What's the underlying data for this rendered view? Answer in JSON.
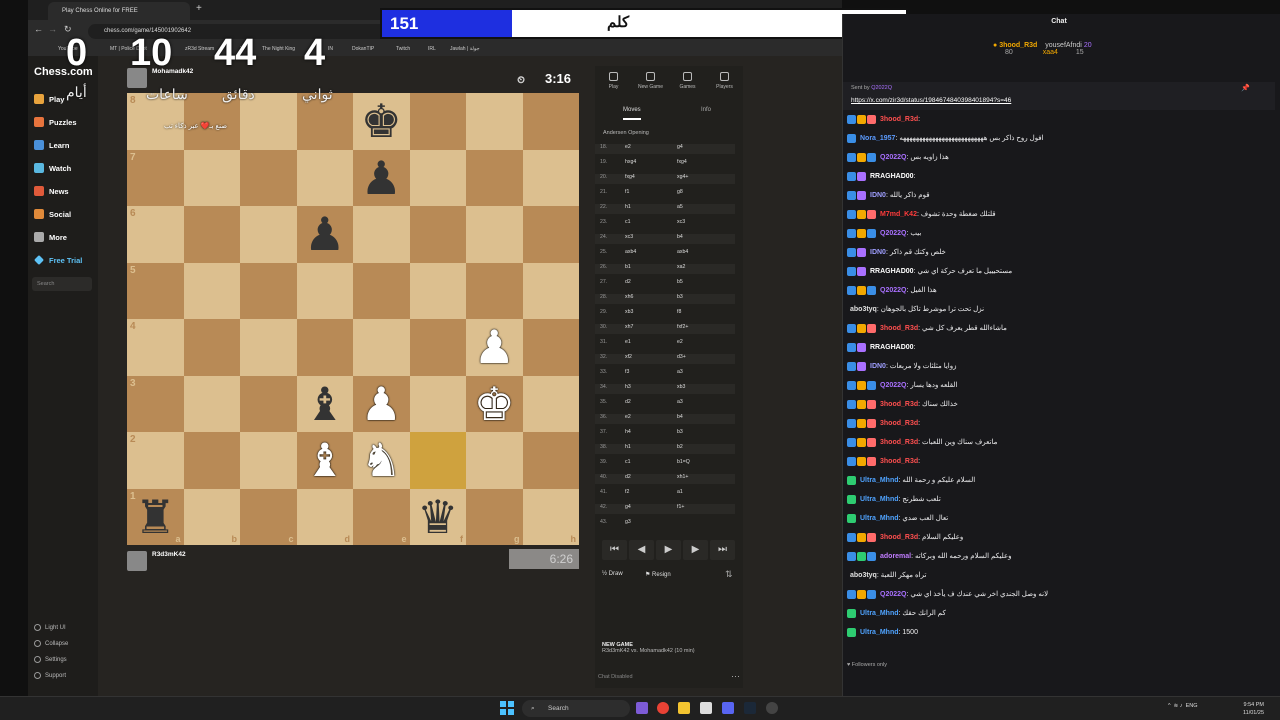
{
  "browser": {
    "tab_title": "Play Chess Online for FREE",
    "url": "chess.com/game/145001902642",
    "bookmarks": [
      "YouTube",
      "MT | Police Dept",
      "zR3d Stream",
      "X",
      "IN",
      "The Night King",
      "DokanTIP",
      "Twitch",
      "IRL",
      "Jawlah | جولة"
    ]
  },
  "overlay": {
    "blue_score": "151",
    "center_word": "كلم",
    "right_score": "593",
    "countdown": {
      "days": "0",
      "hours": "10",
      "minutes": "44",
      "seconds": "4"
    },
    "countdown_labels": {
      "days": "أيام",
      "hours": "ساعات",
      "minutes": "دقائق",
      "seconds": "ثواني"
    },
    "credit": "صنع بـ❤️ عبر ذكاء تب"
  },
  "chess_sidebar": {
    "logo": "Chess.com",
    "items": [
      "Play",
      "Puzzles",
      "Learn",
      "Watch",
      "News",
      "Social",
      "More",
      "Free Trial"
    ],
    "search_placeholder": "Search",
    "bottom": [
      "Light UI",
      "Collapse",
      "Settings",
      "Support"
    ]
  },
  "game": {
    "top_player": {
      "name": "Mohamadk42",
      "clock": "3:16"
    },
    "bottom_player": {
      "name": "R3d3mK42",
      "clock": "6:26"
    },
    "ranks": [
      "8",
      "7",
      "6",
      "5",
      "4",
      "3",
      "2",
      "1"
    ],
    "files": [
      "a",
      "b",
      "c",
      "d",
      "e",
      "f",
      "g",
      "h"
    ],
    "pieces": [
      {
        "square": "e8",
        "glyph": "♚",
        "color": "black",
        "name": "black-king"
      },
      {
        "square": "e7",
        "glyph": "♟",
        "color": "black",
        "name": "black-pawn"
      },
      {
        "square": "d6",
        "glyph": "♟",
        "color": "black",
        "name": "black-pawn"
      },
      {
        "square": "g4",
        "glyph": "♟",
        "color": "white",
        "name": "white-pawn"
      },
      {
        "square": "d3",
        "glyph": "♝",
        "color": "black",
        "name": "black-bishop"
      },
      {
        "square": "e3",
        "glyph": "♟",
        "color": "white",
        "name": "white-pawn"
      },
      {
        "square": "g3",
        "glyph": "♚",
        "color": "white",
        "name": "white-king"
      },
      {
        "square": "d2",
        "glyph": "♝",
        "color": "white",
        "name": "white-bishop"
      },
      {
        "square": "e2",
        "glyph": "♞",
        "color": "white",
        "name": "white-knight"
      },
      {
        "square": "a1",
        "glyph": "♜",
        "color": "black",
        "name": "black-rook"
      },
      {
        "square": "f1",
        "glyph": "♛",
        "color": "black",
        "name": "black-queen"
      }
    ],
    "highlight": [
      "f2"
    ]
  },
  "panel": {
    "tabs": [
      "Play",
      "New Game",
      "Games",
      "Players"
    ],
    "subtabs": [
      "Moves",
      "Info"
    ],
    "opening": "Andersen Opening",
    "moves": [
      {
        "n": "18.",
        "w": "e2",
        "b": "g4"
      },
      {
        "n": "19.",
        "w": "hxg4",
        "b": "fxg4"
      },
      {
        "n": "20.",
        "w": "fxg4",
        "b": "xg4+"
      },
      {
        "n": "21.",
        "w": "f1",
        "b": "g8"
      },
      {
        "n": "22.",
        "w": "h1",
        "b": "a5"
      },
      {
        "n": "23.",
        "w": "c1",
        "b": "xc3"
      },
      {
        "n": "24.",
        "w": "xc3",
        "b": "b4"
      },
      {
        "n": "25.",
        "w": "axb4",
        "b": "axb4"
      },
      {
        "n": "26.",
        "w": "b1",
        "b": "xa2"
      },
      {
        "n": "27.",
        "w": "d2",
        "b": "b5"
      },
      {
        "n": "28.",
        "w": "xh6",
        "b": "b3"
      },
      {
        "n": "29.",
        "w": "xb3",
        "b": "f8"
      },
      {
        "n": "30.",
        "w": "xh7",
        "b": "fxf2+"
      },
      {
        "n": "31.",
        "w": "e1",
        "b": "e2"
      },
      {
        "n": "32.",
        "w": "xf2",
        "b": "d3+"
      },
      {
        "n": "33.",
        "w": "f3",
        "b": "a3"
      },
      {
        "n": "34.",
        "w": "h3",
        "b": "xb3"
      },
      {
        "n": "35.",
        "w": "d2",
        "b": "a3"
      },
      {
        "n": "36.",
        "w": "e2",
        "b": "b4"
      },
      {
        "n": "37.",
        "w": "h4",
        "b": "b3"
      },
      {
        "n": "38.",
        "w": "h1",
        "b": "b2"
      },
      {
        "n": "39.",
        "w": "c1",
        "b": "b1=Q"
      },
      {
        "n": "40.",
        "w": "d2",
        "b": "xh1+"
      },
      {
        "n": "41.",
        "w": "f2",
        "b": "a1"
      },
      {
        "n": "42.",
        "w": "g4",
        "b": "f1+"
      },
      {
        "n": "43.",
        "w": "g3",
        "b": ""
      }
    ],
    "draw": "Draw",
    "resign": "Resign",
    "new_game_title": "NEW GAME",
    "new_game_desc": "R3d3mK42 vs. Mohamadk42 (10 min)",
    "chat_disabled": "Chat Disabled"
  },
  "chat": {
    "title": "Chat",
    "top_users": [
      {
        "name": "3hood_R3d",
        "count": "80"
      },
      {
        "name": "yousefAfndi",
        "count": "20"
      },
      {
        "name": "xaa4",
        "count": "15"
      }
    ],
    "pinned_sender": "Sent by",
    "pinned_sender_name": "Q2022Q",
    "pinned_link": "https://x.com/zir3d/status/1984674840398401894?s=46",
    "messages": [
      {
        "user": "3hood_R3d",
        "color": "#ff4f4f",
        "text": ":",
        "badges": [
          "#3a8ee6",
          "#f2a800",
          "#ff6b6b"
        ]
      },
      {
        "user": "Nora_1957",
        "color": "#5b9bff",
        "text": ": افول روح ذاكر بس ههههههههههههههههههههههههههه",
        "badges": [
          "#3a8ee6"
        ]
      },
      {
        "user": "Q2022Q",
        "color": "#a970ff",
        "text": ": هذا زاويه بس",
        "badges": [
          "#3a8ee6",
          "#f2a800",
          "#3a8ee6"
        ]
      },
      {
        "user": "RRAGHAD00",
        "color": "#ffffff",
        "text": ":",
        "badges": [
          "#3a8ee6",
          "#a970ff"
        ]
      },
      {
        "user": "IDN0",
        "color": "#9e9eff",
        "text": ": قوم ذاكر يالله",
        "badges": [
          "#3a8ee6",
          "#a970ff"
        ]
      },
      {
        "user": "M7md_K42",
        "color": "#ff3b3b",
        "text": ": قلتلك ضغطة وحدة تشوف",
        "badges": [
          "#3a8ee6",
          "#f2a800",
          "#ff6b6b"
        ]
      },
      {
        "user": "Q2022Q",
        "color": "#a970ff",
        "text": ": بيب",
        "badges": [
          "#3a8ee6",
          "#f2a800",
          "#3a8ee6"
        ]
      },
      {
        "user": "IDN0",
        "color": "#9e9eff",
        "text": ": خلص وكتك قم ذاكر",
        "badges": [
          "#3a8ee6",
          "#a970ff"
        ]
      },
      {
        "user": "RRAGHAD00",
        "color": "#ffffff",
        "text": ": مستحيييل ما تعرف حركة اي شي",
        "badges": [
          "#3a8ee6",
          "#a970ff"
        ]
      },
      {
        "user": "Q2022Q",
        "color": "#a970ff",
        "text": ": هذا الفيل",
        "badges": [
          "#3a8ee6",
          "#f2a800",
          "#3a8ee6"
        ]
      },
      {
        "user": "abo3tyq",
        "color": "#e0e0e0",
        "text": ": نزل تحت ترا موشرط تاكل بالجوهان",
        "badges": []
      },
      {
        "user": "3hood_R3d",
        "color": "#ff4f4f",
        "text": ": ماشاءالله قطر يعرف كل شي",
        "badges": [
          "#3a8ee6",
          "#f2a800",
          "#ff6b6b"
        ]
      },
      {
        "user": "RRAGHAD00",
        "color": "#ffffff",
        "text": ":",
        "badges": [
          "#3a8ee6",
          "#a970ff"
        ]
      },
      {
        "user": "IDN0",
        "color": "#9e9eff",
        "text": ": زوايا مثلثات ولا مربعات",
        "badges": [
          "#3a8ee6",
          "#a970ff"
        ]
      },
      {
        "user": "Q2022Q",
        "color": "#a970ff",
        "text": ": القلعه ودها يسار",
        "badges": [
          "#3a8ee6",
          "#f2a800",
          "#3a8ee6"
        ]
      },
      {
        "user": "3hood_R3d",
        "color": "#ff4f4f",
        "text": ": خذالك سناك",
        "badges": [
          "#3a8ee6",
          "#f2a800",
          "#ff6b6b"
        ]
      },
      {
        "user": "3hood_R3d",
        "color": "#ff4f4f",
        "text": ":",
        "badges": [
          "#3a8ee6",
          "#f2a800",
          "#ff6b6b"
        ]
      },
      {
        "user": "3hood_R3d",
        "color": "#ff4f4f",
        "text": ": ماتعرف سناك وين اللعبات",
        "badges": [
          "#3a8ee6",
          "#f2a800",
          "#ff6b6b"
        ]
      },
      {
        "user": "3hood_R3d",
        "color": "#ff4f4f",
        "text": ":",
        "badges": [
          "#3a8ee6",
          "#f2a800",
          "#ff6b6b"
        ]
      },
      {
        "user": "Ultra_Mhnd",
        "color": "#4fa3ff",
        "text": ": السلام عليكم و رحمة الله",
        "badges": [
          "#2ecc71"
        ]
      },
      {
        "user": "Ultra_Mhnd",
        "color": "#4fa3ff",
        "text": ": تلعب شطرنج",
        "badges": [
          "#2ecc71"
        ]
      },
      {
        "user": "Ultra_Mhnd",
        "color": "#4fa3ff",
        "text": ": تعال العب ضدي",
        "badges": [
          "#2ecc71"
        ]
      },
      {
        "user": "3hood_R3d",
        "color": "#ff4f4f",
        "text": ": وعليكم السلام",
        "badges": [
          "#3a8ee6",
          "#f2a800",
          "#ff6b6b"
        ]
      },
      {
        "user": "adoremal",
        "color": "#c07cff",
        "text": ": وعليكم السلام ورحمه الله وبركاته",
        "badges": [
          "#3a8ee6",
          "#2ecc71",
          "#3a8ee6"
        ]
      },
      {
        "user": "abo3tyq",
        "color": "#e0e0e0",
        "text": ": تراه مهكر اللعبة",
        "badges": []
      },
      {
        "user": "Q2022Q",
        "color": "#a970ff",
        "text": ": لانه وصل الجندي اخر شي عندك ف يأخذ اي شي",
        "badges": [
          "#3a8ee6",
          "#f2a800",
          "#3a8ee6"
        ]
      },
      {
        "user": "Ultra_Mhnd",
        "color": "#4fa3ff",
        "text": ": كم الرانك حقك",
        "badges": [
          "#2ecc71"
        ]
      },
      {
        "user": "Ultra_Mhnd",
        "color": "#4fa3ff",
        "text": ": 1500",
        "badges": [
          "#2ecc71"
        ]
      }
    ],
    "followers_only": "Followers only"
  },
  "taskbar": {
    "search": "Search",
    "lang": "ENG",
    "time": "9:54 PM",
    "date": "11/01/25"
  }
}
